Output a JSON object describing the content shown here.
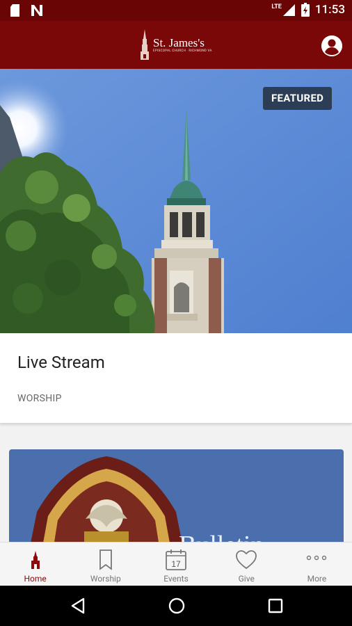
{
  "status_bar": {
    "time": "11:53",
    "network": "LTE"
  },
  "app_bar": {
    "logo_title": "St. James's",
    "logo_subtitle": "EPISCOPAL CHURCH · RICHMOND VA"
  },
  "featured": {
    "badge": "FEATURED",
    "title": "Live Stream",
    "category": "WORSHIP"
  },
  "bulletin": {
    "title": "Bulletin"
  },
  "tabs": [
    {
      "label": "Home",
      "icon": "church-icon",
      "active": true
    },
    {
      "label": "Worship",
      "icon": "bookmark-icon",
      "active": false
    },
    {
      "label": "Events",
      "icon": "calendar-icon",
      "active": false,
      "calendar_day": "17"
    },
    {
      "label": "Give",
      "icon": "heart-icon",
      "active": false
    },
    {
      "label": "More",
      "icon": "more-icon",
      "active": false
    }
  ],
  "colors": {
    "brand": "#7a0808",
    "status_bar": "#6a0505",
    "badge": "#2c3e55",
    "bulletin_bg": "#4a6fac",
    "active_tab": "#8b0a0a"
  }
}
